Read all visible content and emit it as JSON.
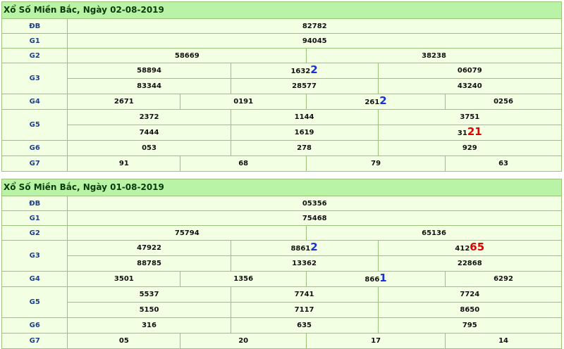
{
  "colors": {
    "title_bg": "#b8f3a6",
    "row_bg": "#f3ffe3",
    "border": "#9bc27a",
    "label": "#1d3e8a",
    "highlight_blue": "#1a2fd6",
    "highlight_red": "#e00000"
  },
  "tables": [
    {
      "title": "Xổ Số Miền Bắc, Ngày 02-08-2019",
      "prizes": {
        "db": {
          "label": "ĐB",
          "value": "82782"
        },
        "g1": {
          "label": "G1",
          "value": "94045"
        },
        "g2": {
          "label": "G2",
          "values": [
            "58669",
            "38238"
          ]
        },
        "g3": {
          "label": "G3",
          "row1": [
            {
              "base": "58894",
              "hl": "",
              "hl_color": ""
            },
            {
              "base": "1632",
              "hl": "2",
              "hl_color": "blue"
            },
            {
              "base": "06079",
              "hl": "",
              "hl_color": ""
            }
          ],
          "row2": [
            "83344",
            "28577",
            "43240"
          ]
        },
        "g4": {
          "label": "G4",
          "values": [
            {
              "base": "2671",
              "hl": "",
              "hl_color": ""
            },
            {
              "base": "0191",
              "hl": "",
              "hl_color": ""
            },
            {
              "base": "261",
              "hl": "2",
              "hl_color": "blue"
            },
            {
              "base": "0256",
              "hl": "",
              "hl_color": ""
            }
          ]
        },
        "g5": {
          "label": "G5",
          "row1": [
            "2372",
            "1144",
            "3751"
          ],
          "row2": [
            {
              "base": "7444",
              "hl": "",
              "hl_color": ""
            },
            {
              "base": "1619",
              "hl": "",
              "hl_color": ""
            },
            {
              "base": "31",
              "hl": "21",
              "hl_color": "red"
            }
          ]
        },
        "g6": {
          "label": "G6",
          "values": [
            "053",
            "278",
            "929"
          ]
        },
        "g7": {
          "label": "G7",
          "values": [
            "91",
            "68",
            "79",
            "63"
          ]
        }
      }
    },
    {
      "title": "Xổ Số Miền Bắc, Ngày 01-08-2019",
      "prizes": {
        "db": {
          "label": "ĐB",
          "value": "05356"
        },
        "g1": {
          "label": "G1",
          "value": "75468"
        },
        "g2": {
          "label": "G2",
          "values": [
            "75794",
            "65136"
          ]
        },
        "g3": {
          "label": "G3",
          "row1": [
            {
              "base": "47922",
              "hl": "",
              "hl_color": ""
            },
            {
              "base": "8861",
              "hl": "2",
              "hl_color": "blue"
            },
            {
              "base": "412",
              "hl": "65",
              "hl_color": "red"
            }
          ],
          "row2": [
            "88785",
            "13362",
            "22868"
          ]
        },
        "g4": {
          "label": "G4",
          "values": [
            {
              "base": "3501",
              "hl": "",
              "hl_color": ""
            },
            {
              "base": "1356",
              "hl": "",
              "hl_color": ""
            },
            {
              "base": "866",
              "hl": "1",
              "hl_color": "blue"
            },
            {
              "base": "6292",
              "hl": "",
              "hl_color": ""
            }
          ]
        },
        "g5": {
          "label": "G5",
          "row1": [
            "5537",
            "7741",
            "7724"
          ],
          "row2": [
            {
              "base": "5150",
              "hl": "",
              "hl_color": ""
            },
            {
              "base": "7117",
              "hl": "",
              "hl_color": ""
            },
            {
              "base": "8650",
              "hl": "",
              "hl_color": ""
            }
          ]
        },
        "g6": {
          "label": "G6",
          "values": [
            "316",
            "635",
            "795"
          ]
        },
        "g7": {
          "label": "G7",
          "values": [
            "05",
            "20",
            "17",
            "14"
          ]
        }
      }
    }
  ]
}
